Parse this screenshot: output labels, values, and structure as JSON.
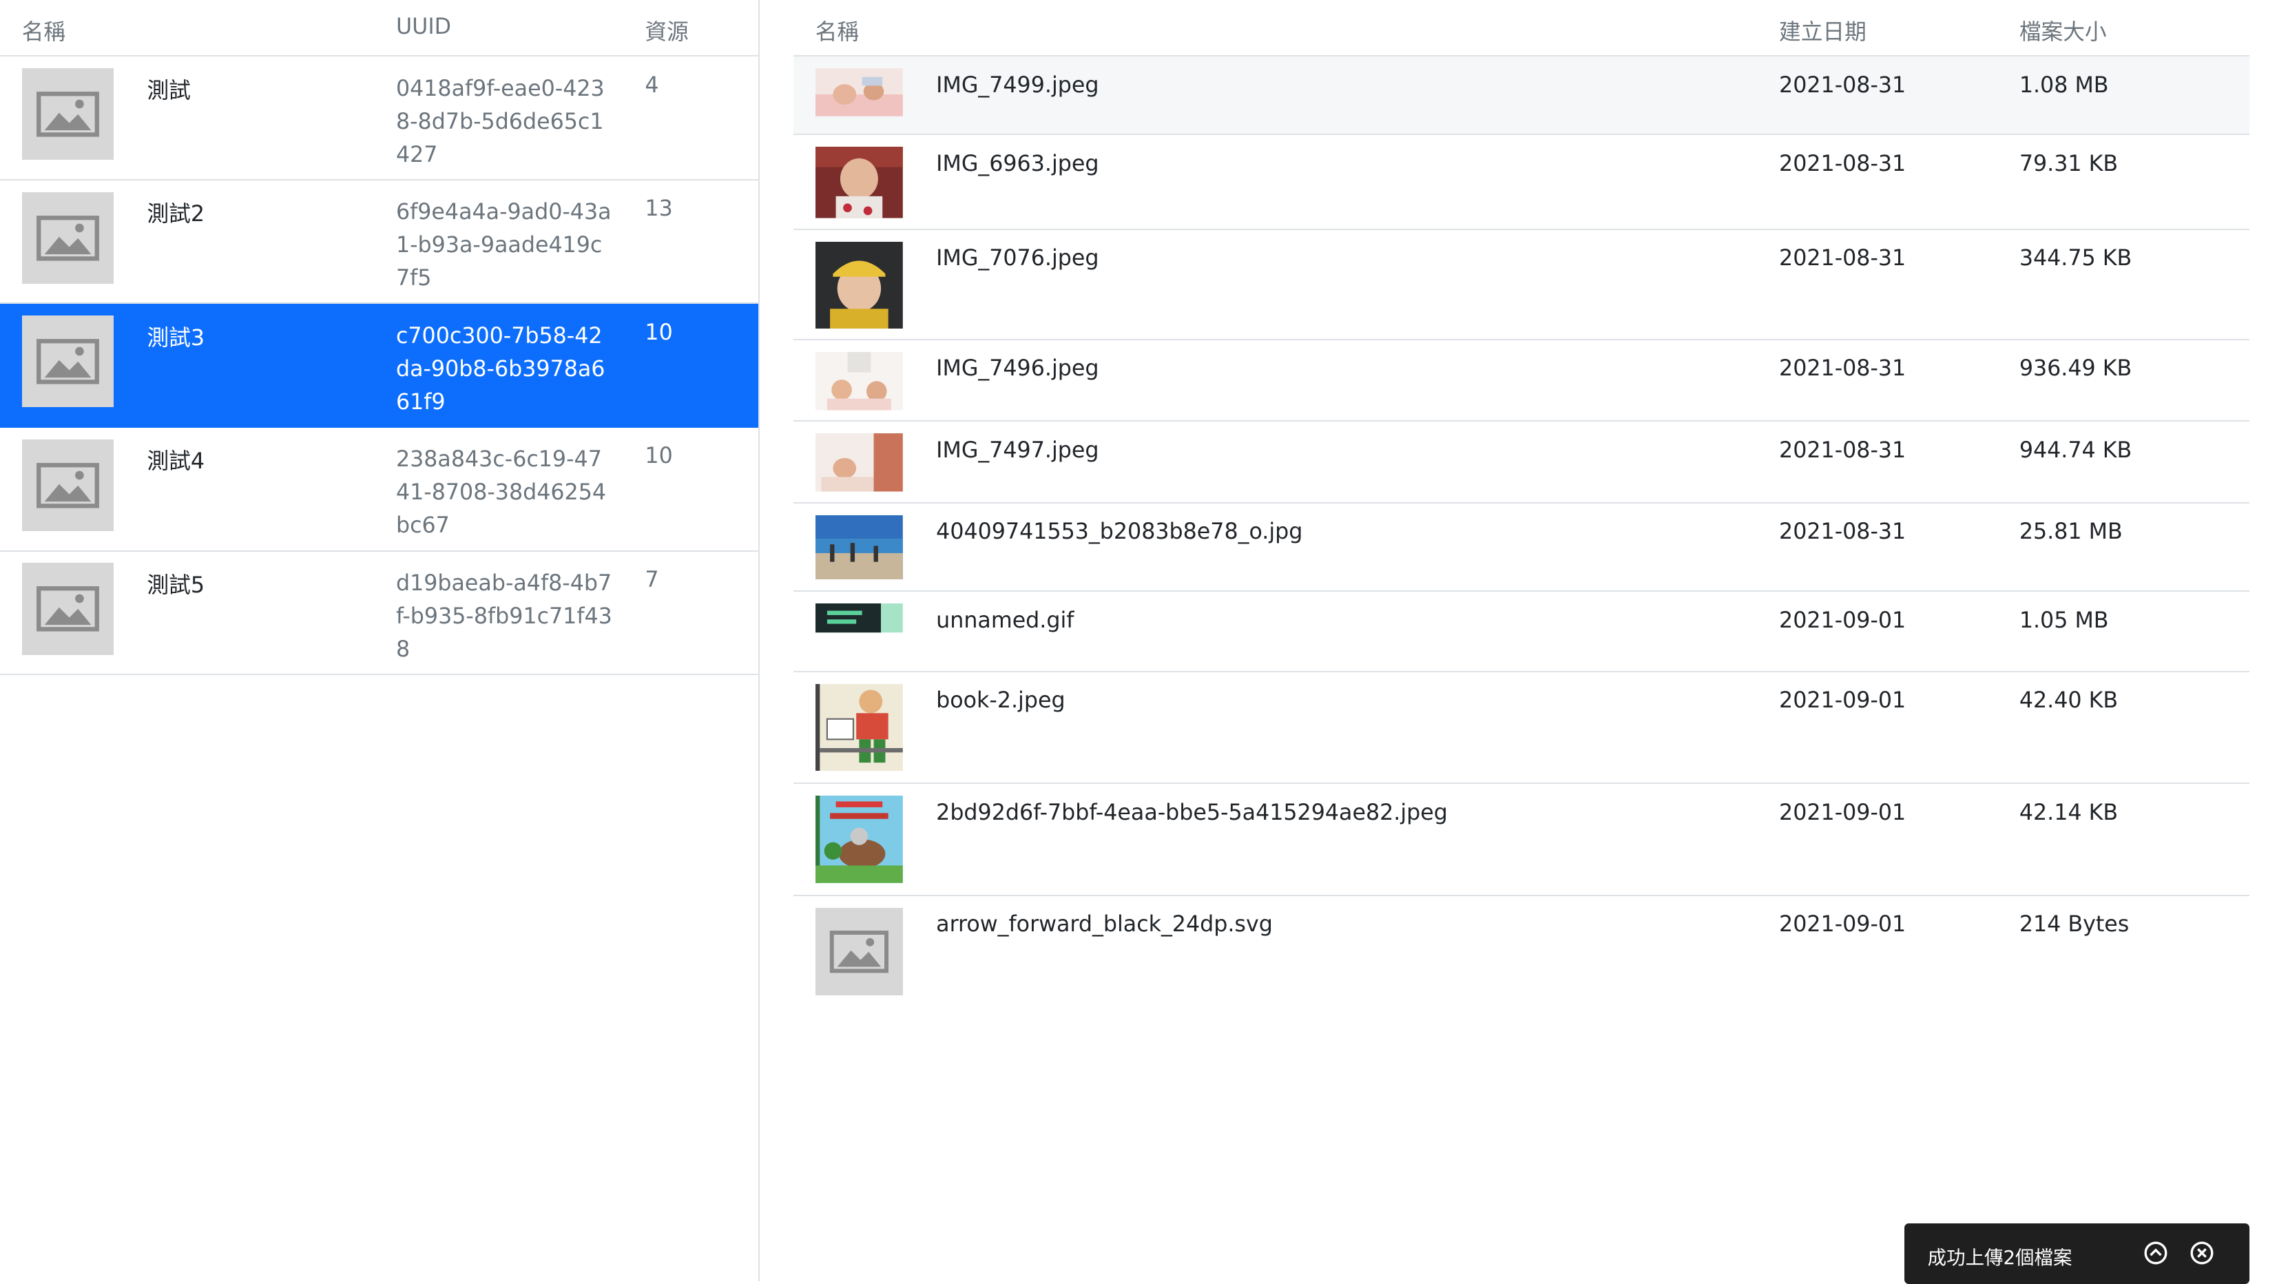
{
  "collections": {
    "headers": {
      "name": "名稱",
      "uuid": "UUID",
      "resources": "資源"
    },
    "rows": [
      {
        "name": "測試",
        "uuid": "0418af9f-eae0-4238-8d7b-5d6de65c1427",
        "count": "4",
        "selected": false
      },
      {
        "name": "測試2",
        "uuid": "6f9e4a4a-9ad0-43a1-b93a-9aade419c7f5",
        "count": "13",
        "selected": false
      },
      {
        "name": "測試3",
        "uuid": "c700c300-7b58-42da-90b8-6b3978a661f9",
        "count": "10",
        "selected": true
      },
      {
        "name": "測試4",
        "uuid": "238a843c-6c19-4741-8708-38d46254bc67",
        "count": "10",
        "selected": false
      },
      {
        "name": "測試5",
        "uuid": "d19baeab-a4f8-4b7f-b935-8fb91c71f438",
        "count": "7",
        "selected": false
      }
    ]
  },
  "files": {
    "headers": {
      "name": "名稱",
      "created": "建立日期",
      "size": "檔案大小"
    },
    "rows": [
      {
        "name": "IMG_7499.jpeg",
        "date": "2021-08-31",
        "size": "1.08 MB"
      },
      {
        "name": "IMG_6963.jpeg",
        "date": "2021-08-31",
        "size": "79.31 KB"
      },
      {
        "name": "IMG_7076.jpeg",
        "date": "2021-08-31",
        "size": "344.75 KB"
      },
      {
        "name": "IMG_7496.jpeg",
        "date": "2021-08-31",
        "size": "936.49 KB"
      },
      {
        "name": "IMG_7497.jpeg",
        "date": "2021-08-31",
        "size": "944.74 KB"
      },
      {
        "name": "40409741553_b2083b8e78_o.jpg",
        "date": "2021-08-31",
        "size": "25.81 MB"
      },
      {
        "name": "unnamed.gif",
        "date": "2021-09-01",
        "size": "1.05 MB"
      },
      {
        "name": "book-2.jpeg",
        "date": "2021-09-01",
        "size": "42.40 KB"
      },
      {
        "name": "2bd92d6f-7bbf-4eaa-bbe5-5a415294ae82.jpeg",
        "date": "2021-09-01",
        "size": "42.14 KB"
      },
      {
        "name": "arrow_forward_black_24dp.svg",
        "date": "2021-09-01",
        "size": "214 Bytes"
      }
    ]
  },
  "toast": {
    "message": "成功上傳2個檔案",
    "expand_icon": "chevron-up-circle-icon",
    "close_icon": "close-circle-icon"
  },
  "colors": {
    "selected": "#0d6efd",
    "toast_bg": "#1f1f1f",
    "placeholder": "#d7d7d7"
  }
}
